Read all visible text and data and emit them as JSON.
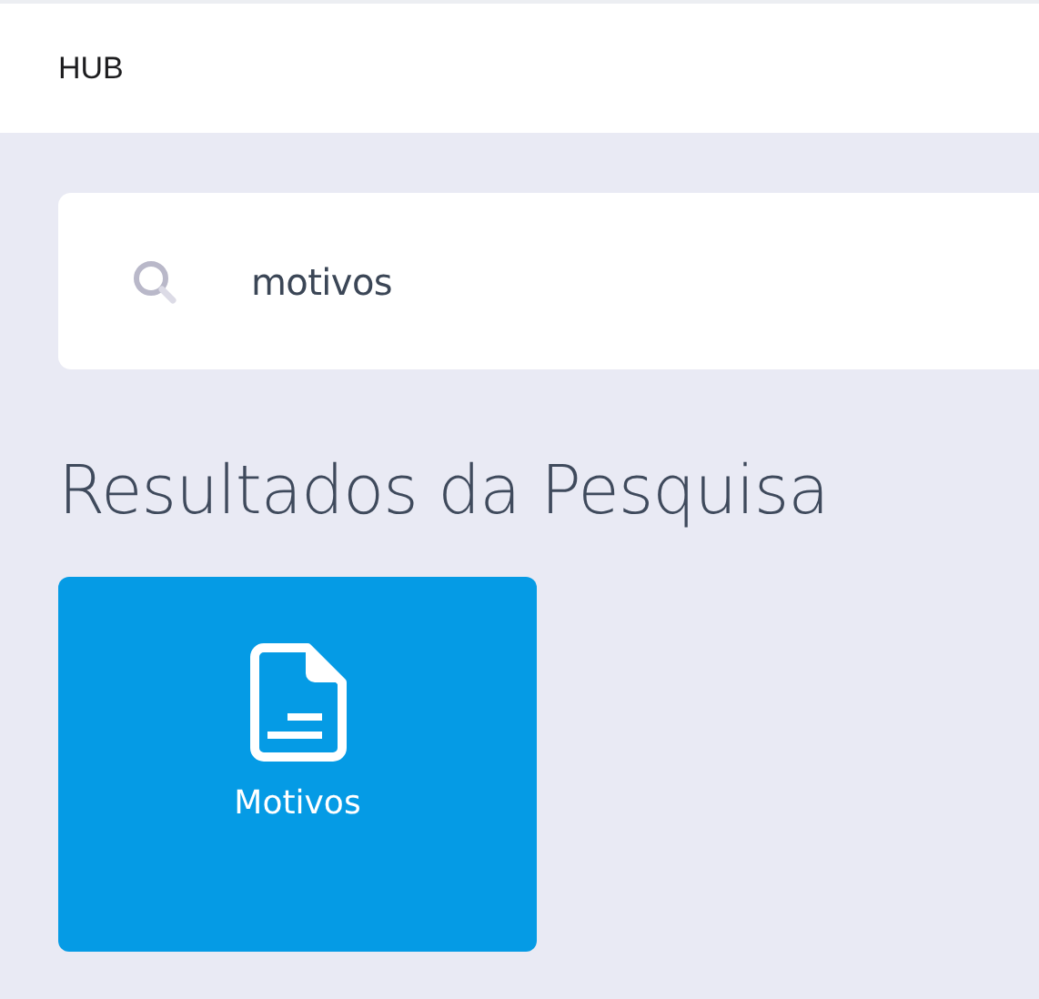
{
  "header": {
    "title": "HUB"
  },
  "search": {
    "value": "motivos"
  },
  "results": {
    "heading": "Resultados da Pesquisa",
    "items": [
      {
        "label": "Motivos",
        "kind": "document"
      }
    ]
  }
}
